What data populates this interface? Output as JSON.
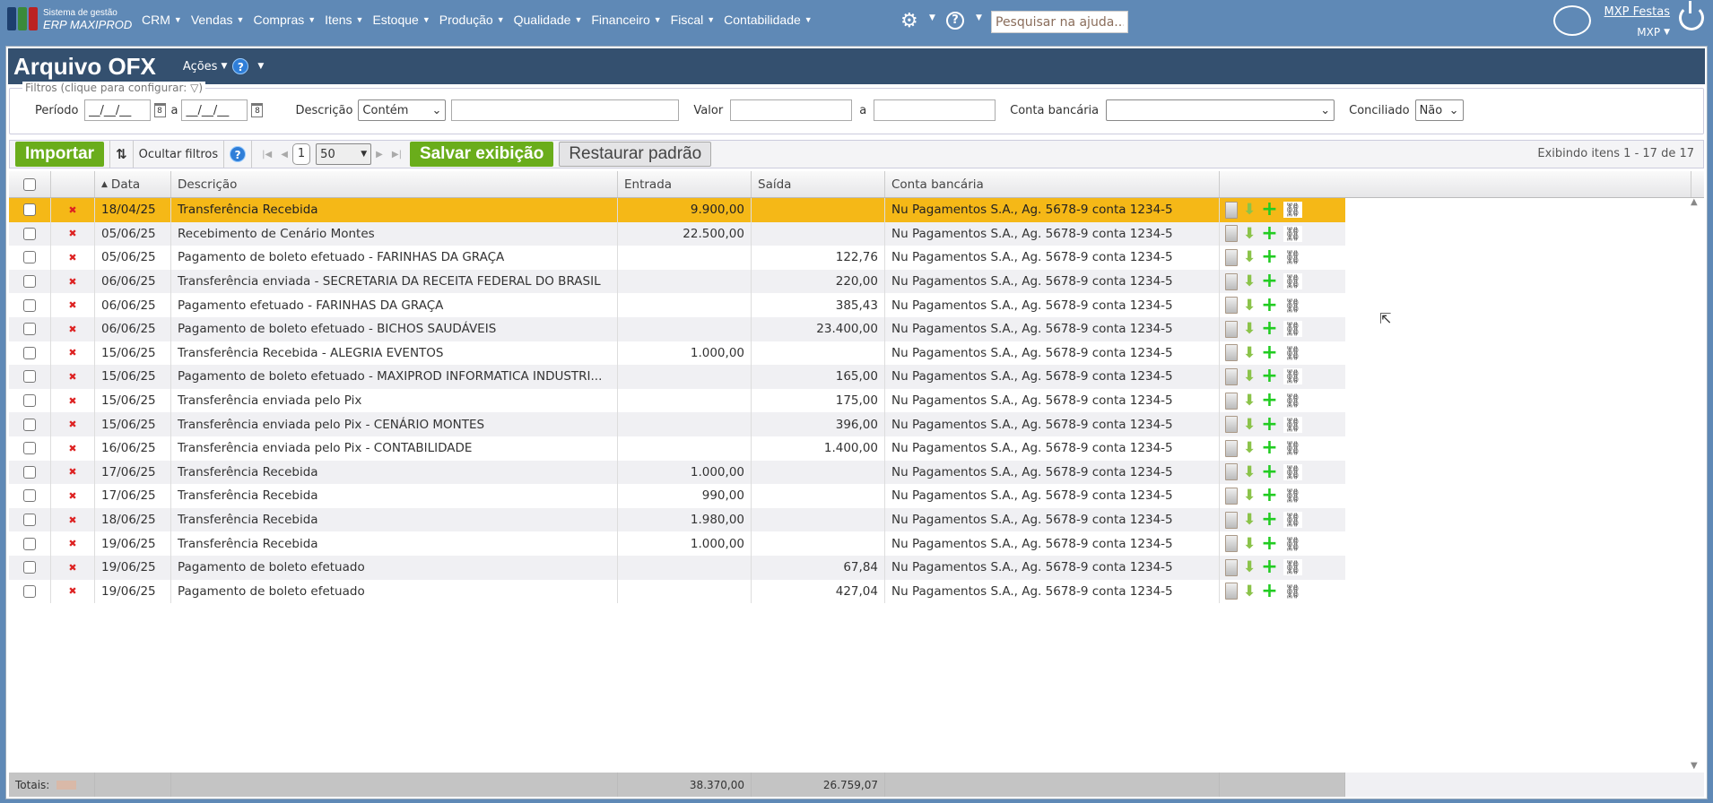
{
  "app": {
    "logo_line1": "Sistema de gestão",
    "logo_line2": "ERP MAXIPROD",
    "help_search_placeholder": "Pesquisar na ajuda...",
    "user_name": "MXP Festas",
    "company": "MXP"
  },
  "menu": [
    "CRM",
    "Vendas",
    "Compras",
    "Itens",
    "Estoque",
    "Produção",
    "Qualidade",
    "Financeiro",
    "Fiscal",
    "Contabilidade"
  ],
  "page": {
    "title": "Arquivo OFX",
    "actions": "Ações"
  },
  "filters": {
    "legend": "Filtros (clique para configurar:",
    "legend_end": ")",
    "periodo_label": "Período",
    "date_placeholder": "__/__/__",
    "a": "a",
    "descricao_label": "Descrição",
    "descricao_mode": "Contém",
    "descricao_value": "",
    "valor_label": "Valor",
    "conta_label": "Conta bancária",
    "conta_value": "",
    "conciliado_label": "Conciliado",
    "conciliado_value": "Não"
  },
  "toolbar": {
    "import": "Importar",
    "hide_filters": "Ocultar filtros",
    "page": "1",
    "page_size": "50",
    "save_view": "Salvar exibição",
    "restore": "Restaurar padrão",
    "count": "Exibindo itens 1 - 17 de 17"
  },
  "columns": {
    "date": "Data",
    "description": "Descrição",
    "entrada": "Entrada",
    "saida": "Saída",
    "conta": "Conta bancária"
  },
  "rows": [
    {
      "date": "18/04/25",
      "desc": "Transferência Recebida",
      "entrada": "9.900,00",
      "saida": "",
      "conta": "Nu Pagamentos S.A., Ag. 5678-9 conta 1234-5",
      "selected": true
    },
    {
      "date": "05/06/25",
      "desc": "Recebimento de Cenário Montes",
      "entrada": "22.500,00",
      "saida": "",
      "conta": "Nu Pagamentos S.A., Ag. 5678-9 conta 1234-5"
    },
    {
      "date": "05/06/25",
      "desc": "Pagamento de boleto efetuado - FARINHAS DA GRAÇA",
      "entrada": "",
      "saida": "122,76",
      "conta": "Nu Pagamentos S.A., Ag. 5678-9 conta 1234-5"
    },
    {
      "date": "06/06/25",
      "desc": "Transferência enviada - SECRETARIA DA RECEITA FEDERAL DO BRASIL",
      "entrada": "",
      "saida": "220,00",
      "conta": "Nu Pagamentos S.A., Ag. 5678-9 conta 1234-5"
    },
    {
      "date": "06/06/25",
      "desc": "Pagamento efetuado - FARINHAS DA GRAÇA",
      "entrada": "",
      "saida": "385,43",
      "conta": "Nu Pagamentos S.A., Ag. 5678-9 conta 1234-5"
    },
    {
      "date": "06/06/25",
      "desc": "Pagamento de boleto efetuado - BICHOS SAUDÁVEIS",
      "entrada": "",
      "saida": "23.400,00",
      "conta": "Nu Pagamentos S.A., Ag. 5678-9 conta 1234-5"
    },
    {
      "date": "15/06/25",
      "desc": "Transferência Recebida - ALEGRIA EVENTOS",
      "entrada": "1.000,00",
      "saida": "",
      "conta": "Nu Pagamentos S.A., Ag. 5678-9 conta 1234-5"
    },
    {
      "date": "15/06/25",
      "desc": "Pagamento de boleto efetuado - MAXIPROD INFORMATICA INDUSTRI...",
      "entrada": "",
      "saida": "165,00",
      "conta": "Nu Pagamentos S.A., Ag. 5678-9 conta 1234-5"
    },
    {
      "date": "15/06/25",
      "desc": "Transferência enviada pelo Pix",
      "entrada": "",
      "saida": "175,00",
      "conta": "Nu Pagamentos S.A., Ag. 5678-9 conta 1234-5"
    },
    {
      "date": "15/06/25",
      "desc": "Transferência enviada pelo Pix - CENÁRIO MONTES",
      "entrada": "",
      "saida": "396,00",
      "conta": "Nu Pagamentos S.A., Ag. 5678-9 conta 1234-5"
    },
    {
      "date": "16/06/25",
      "desc": "Transferência enviada pelo Pix - CONTABILIDADE",
      "entrada": "",
      "saida": "1.400,00",
      "conta": "Nu Pagamentos S.A., Ag. 5678-9 conta 1234-5"
    },
    {
      "date": "17/06/25",
      "desc": "Transferência Recebida",
      "entrada": "1.000,00",
      "saida": "",
      "conta": "Nu Pagamentos S.A., Ag. 5678-9 conta 1234-5"
    },
    {
      "date": "17/06/25",
      "desc": "Transferência Recebida",
      "entrada": "990,00",
      "saida": "",
      "conta": "Nu Pagamentos S.A., Ag. 5678-9 conta 1234-5"
    },
    {
      "date": "18/06/25",
      "desc": "Transferência Recebida",
      "entrada": "1.980,00",
      "saida": "",
      "conta": "Nu Pagamentos S.A., Ag. 5678-9 conta 1234-5"
    },
    {
      "date": "19/06/25",
      "desc": "Transferência Recebida",
      "entrada": "1.000,00",
      "saida": "",
      "conta": "Nu Pagamentos S.A., Ag. 5678-9 conta 1234-5"
    },
    {
      "date": "19/06/25",
      "desc": "Pagamento de boleto efetuado",
      "entrada": "",
      "saida": "67,84",
      "conta": "Nu Pagamentos S.A., Ag. 5678-9 conta 1234-5"
    },
    {
      "date": "19/06/25",
      "desc": "Pagamento de boleto efetuado",
      "entrada": "",
      "saida": "427,04",
      "conta": "Nu Pagamentos S.A., Ag. 5678-9 conta 1234-5"
    }
  ],
  "totals": {
    "label": "Totais:",
    "entrada": "38.370,00",
    "saida": "26.759,07"
  },
  "colors": {
    "topbar": "#5f89b6",
    "titlebar": "#34506f",
    "selected_row": "#f5b817",
    "green_button": "#6aad1b"
  },
  "icons": [
    "gear-icon",
    "help-icon",
    "chat-icon",
    "power-icon",
    "filter-icon",
    "calendar-icon",
    "refresh-icon",
    "delete-icon",
    "clipboard-icon",
    "arrow-down-icon",
    "plus-icon",
    "link-icon"
  ]
}
